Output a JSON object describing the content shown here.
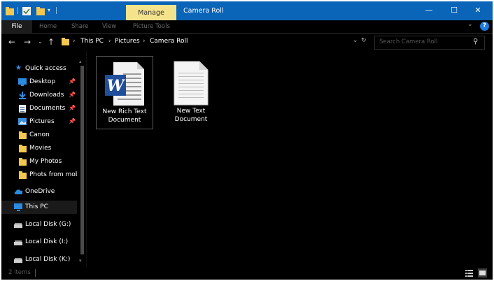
{
  "window": {
    "title": "Camera Roll",
    "contextual_tab": "Manage",
    "controls": {
      "minimize": "—",
      "maximize": "☐",
      "close": "✕"
    }
  },
  "ribbon": {
    "file": "File",
    "tabs": [
      "Home",
      "Share",
      "View",
      "Picture Tools"
    ]
  },
  "address": {
    "crumbs": [
      "This PC",
      "Pictures",
      "Camera Roll"
    ],
    "search_placeholder": "Search Camera Roll"
  },
  "nav": {
    "quick_access": "Quick access",
    "items": [
      {
        "label": "Desktop",
        "pinned": true
      },
      {
        "label": "Downloads",
        "pinned": true
      },
      {
        "label": "Documents",
        "pinned": true
      },
      {
        "label": "Pictures",
        "pinned": true
      },
      {
        "label": "Canon",
        "pinned": false
      },
      {
        "label": "Movies",
        "pinned": false
      },
      {
        "label": "My Photos",
        "pinned": false
      },
      {
        "label": "Phots from mob",
        "pinned": false
      }
    ],
    "onedrive": "OneDrive",
    "this_pc": "This PC",
    "drives": [
      "Local Disk (G:)",
      "Local Disk (I:)",
      "Local Disk (K:)"
    ]
  },
  "files": [
    {
      "name_line1": "New Rich Text",
      "name_line2": "Document",
      "icon": "word-document-icon"
    },
    {
      "name_line1": "New Text",
      "name_line2": "Document",
      "icon": "text-document-icon"
    }
  ],
  "status": {
    "count": "2 items"
  },
  "colors": {
    "titlebar": "#0a64b8",
    "manage": "#f5e38c",
    "folder": "#f4c84e"
  }
}
